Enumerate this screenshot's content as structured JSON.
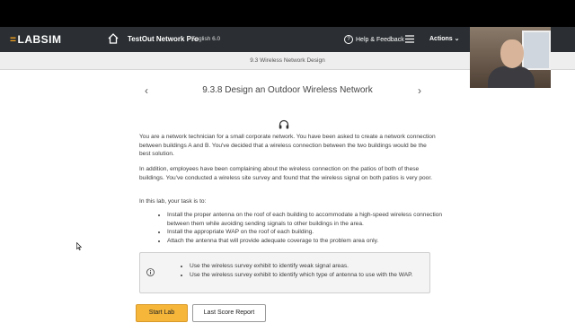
{
  "header": {
    "logo": "LABSIM",
    "product": "TestOut Network Pro",
    "version": "English 6.0",
    "help_label": "Help & Feedback",
    "actions_label": "Actions"
  },
  "breadcrumb": "9.3 Wireless Network Design",
  "page": {
    "title": "9.3.8 Design an Outdoor Wireless Network",
    "intro_1": "You are a network technician for a small corporate network. You have been asked to create a network connection between buildings A and B. You've decided that a wireless connection between the two buildings would be the best solution.",
    "intro_2": "In addition, employees have been complaining about the wireless connection on the patios of both of these buildings. You've conducted a wireless site survey and found that the wireless signal on both patios is very poor.",
    "task_intro": "In this lab, your task is to:",
    "tasks": [
      "Install the proper antenna on the roof of each building to accommodate a high-speed wireless connection between them while avoiding sending signals to other buildings in the area.",
      "Install the appropriate WAP on the roof of each building.",
      "Attach the antenna that will provide adequate coverage to the problem area only."
    ],
    "tips": [
      "Use the wireless survey exhibit to identify weak signal areas.",
      "Use the wireless survey exhibit to identify which type of antenna to use with the WAP."
    ]
  },
  "buttons": {
    "start": "Start Lab",
    "report": "Last Score Report"
  },
  "colors": {
    "header_bg": "#2b2f33",
    "accent": "#f5b63a",
    "logo_accent": "#f2a01e"
  }
}
